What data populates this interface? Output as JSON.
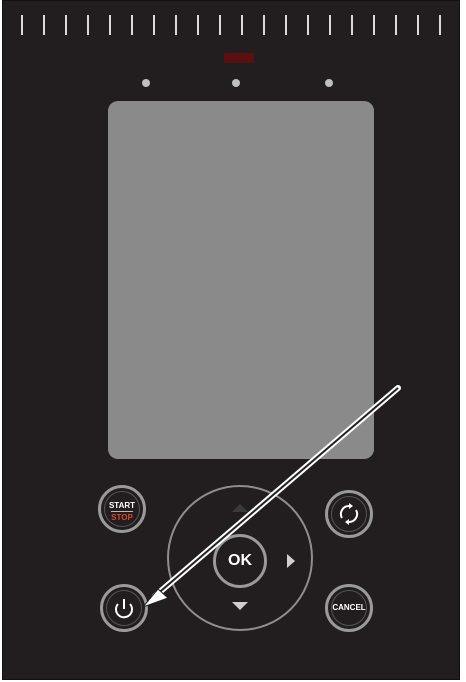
{
  "colors": {
    "panel": "#221d1e",
    "screen": "#8a8a8a",
    "button_ring": "#9a9a9a",
    "stop_text": "#d4482f",
    "annotation_arrow": "#ffffff"
  },
  "controls": {
    "start_label": "START",
    "stop_label": "STOP",
    "ok_label": "OK",
    "cancel_label": "CANCEL"
  },
  "icons": {
    "power": "power-icon",
    "refresh": "refresh-icon",
    "arrow_right": "arrow-right-icon",
    "arrow_down": "arrow-down-icon",
    "arrow_up": "arrow-up-icon"
  }
}
